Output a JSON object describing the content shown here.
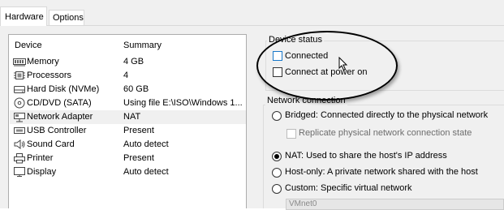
{
  "tabs": [
    {
      "label": "Hardware",
      "active": true
    },
    {
      "label": "Options",
      "active": false
    }
  ],
  "devices": {
    "header_device": "Device",
    "header_summary": "Summary",
    "rows": [
      {
        "icon": "memory-icon",
        "name": "Memory",
        "summary": "4 GB"
      },
      {
        "icon": "processor-icon",
        "name": "Processors",
        "summary": "4"
      },
      {
        "icon": "hard-disk-icon",
        "name": "Hard Disk (NVMe)",
        "summary": "60 GB"
      },
      {
        "icon": "cd-dvd-icon",
        "name": "CD/DVD (SATA)",
        "summary": "Using file E:\\ISO\\Windows 1..."
      },
      {
        "icon": "network-adapter-icon",
        "name": "Network Adapter",
        "summary": "NAT",
        "selected": true
      },
      {
        "icon": "usb-controller-icon",
        "name": "USB Controller",
        "summary": "Present"
      },
      {
        "icon": "sound-card-icon",
        "name": "Sound Card",
        "summary": "Auto detect"
      },
      {
        "icon": "printer-icon",
        "name": "Printer",
        "summary": "Present"
      },
      {
        "icon": "display-icon",
        "name": "Display",
        "summary": "Auto detect"
      }
    ]
  },
  "device_status": {
    "title": "Device status",
    "connected_label": "Connected",
    "connected_checked": false,
    "connect_at_power_on_label": "Connect at power on",
    "connect_at_power_on_checked": false
  },
  "network_connection": {
    "title": "Network connection",
    "bridged_label": "Bridged: Connected directly to the physical network",
    "replicate_label": "Replicate physical network connection state",
    "nat_label": "NAT: Used to share the host's IP address",
    "host_only_label": "Host-only: A private network shared with the host",
    "custom_label": "Custom: Specific virtual network",
    "custom_select_value": "VMnet0",
    "selected": "nat"
  },
  "colors": {
    "focus_border": "#1979ca",
    "selected_row": "#f0f0f0",
    "panel_bg": "#f0f0f0"
  }
}
